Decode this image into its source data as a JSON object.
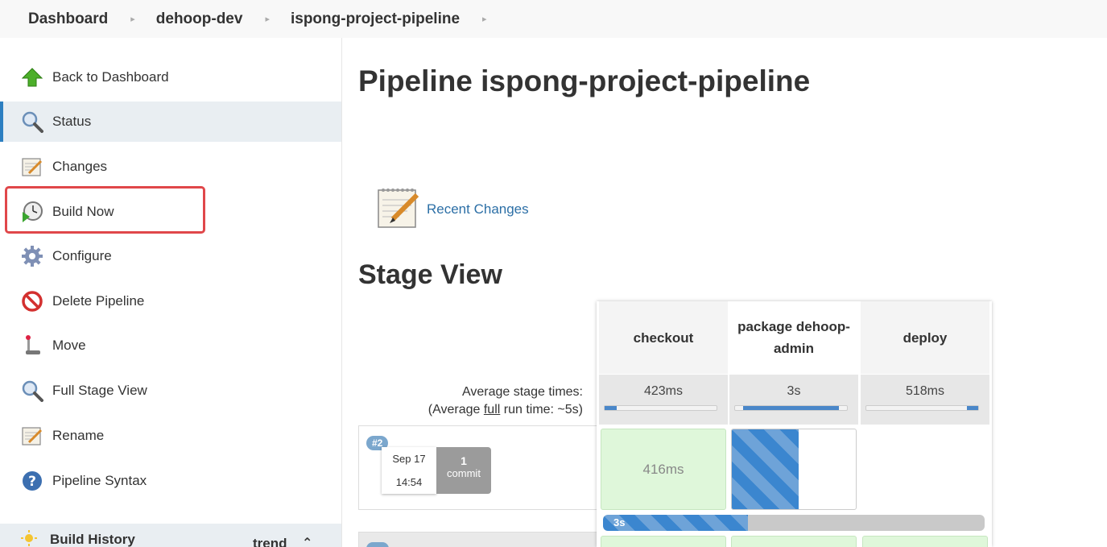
{
  "breadcrumb": [
    "Dashboard",
    "dehoop-dev",
    "ispong-project-pipeline"
  ],
  "sidebar": {
    "items": [
      {
        "label": "Back to Dashboard",
        "icon": "up-arrow-icon"
      },
      {
        "label": "Status",
        "icon": "magnifier-icon"
      },
      {
        "label": "Changes",
        "icon": "notepad-icon"
      },
      {
        "label": "Build Now",
        "icon": "clock-play-icon"
      },
      {
        "label": "Configure",
        "icon": "gear-icon"
      },
      {
        "label": "Delete Pipeline",
        "icon": "no-entry-icon"
      },
      {
        "label": "Move",
        "icon": "move-icon"
      },
      {
        "label": "Full Stage View",
        "icon": "magnifier-icon"
      },
      {
        "label": "Rename",
        "icon": "notepad-icon"
      },
      {
        "label": "Pipeline Syntax",
        "icon": "help-icon"
      }
    ],
    "active": "Status",
    "highlighted": "Build Now",
    "build_history": {
      "label": "Build History",
      "trend": "trend"
    }
  },
  "main": {
    "title": "Pipeline ispong-project-pipeline",
    "recent_changes": "Recent Changes",
    "stage_view_title": "Stage View",
    "avg_times_label": "Average stage times:",
    "avg_run_prefix": "(Average ",
    "avg_run_link": "full",
    "avg_run_suffix": " run time: ~5s)"
  },
  "stages": [
    {
      "name": "checkout",
      "avg": "423ms",
      "avg_fill": 0.11
    },
    {
      "name": "package dehoop-admin",
      "avg": "3s",
      "avg_fill": 0.85
    },
    {
      "name": "deploy",
      "avg": "518ms",
      "avg_fill": 0.1
    }
  ],
  "runs": [
    {
      "badge": "#2",
      "date": "Sep 17",
      "time": "14:54",
      "commit_count": "1",
      "commit_label": "commit",
      "checkout_time": "416ms",
      "progress_label": "3s",
      "progress": 0.38
    }
  ],
  "colors": {
    "accent": "#2d7fc1",
    "success": "#dff7da",
    "progress": "#3b86cf",
    "highlight": "#e0474a"
  }
}
